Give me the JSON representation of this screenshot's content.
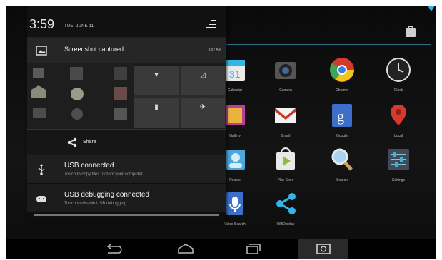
{
  "status": {
    "time": "3:59",
    "date": "TUE, JUNE 11"
  },
  "notifications": {
    "screenshot": {
      "title": "Screenshot captured.",
      "time": "3:57 AM"
    },
    "share": {
      "label": "Share"
    },
    "usb": {
      "title": "USB connected",
      "subtitle": "Touch to copy files to/from your computer."
    },
    "debug": {
      "title": "USB debugging connected",
      "subtitle": "Touch to disable USB debugging."
    }
  },
  "apps": [
    {
      "label": "Calendar",
      "icon": "calendar-icon"
    },
    {
      "label": "Camera",
      "icon": "camera-icon"
    },
    {
      "label": "Chrome",
      "icon": "chrome-icon"
    },
    {
      "label": "Clock",
      "icon": "clock-icon"
    },
    {
      "label": "Gallery",
      "icon": "gallery-icon"
    },
    {
      "label": "Gmail",
      "icon": "gmail-icon"
    },
    {
      "label": "Google",
      "icon": "google-icon"
    },
    {
      "label": "Local",
      "icon": "local-icon"
    },
    {
      "label": "People",
      "icon": "people-icon"
    },
    {
      "label": "Play Store",
      "icon": "play-store-icon"
    },
    {
      "label": "Search",
      "icon": "search-icon"
    },
    {
      "label": "Settings",
      "icon": "settings-icon"
    },
    {
      "label": "Voice Search",
      "icon": "voice-search-icon"
    },
    {
      "label": "WifiDisplay",
      "icon": "share-icon"
    }
  ],
  "colors": {
    "accent": "#33b5e5",
    "shade": "#0e0e0e"
  }
}
